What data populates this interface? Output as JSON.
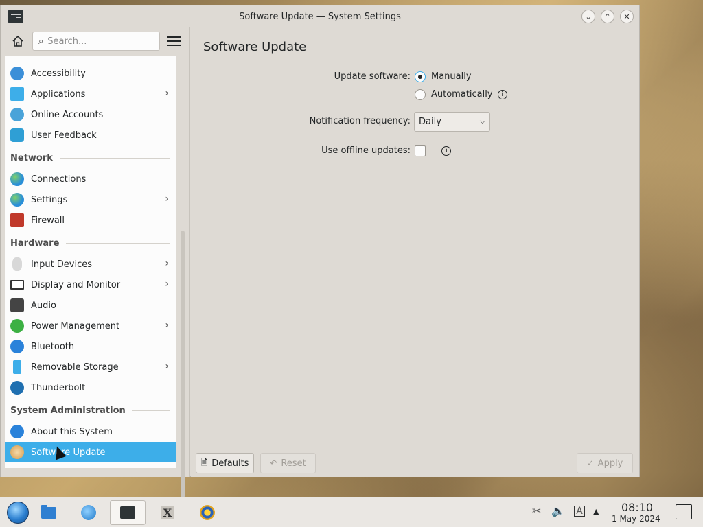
{
  "window": {
    "title": "Software Update — System Settings",
    "buttons": {
      "minimize": "⌄",
      "maximize": "⌃",
      "close": "✕"
    }
  },
  "sidebar": {
    "search_placeholder": "Search...",
    "items_top": [
      {
        "label": "Accessibility",
        "icon": "accessibility-icon",
        "color": "#3b8fd8",
        "chevron": false
      },
      {
        "label": "Applications",
        "icon": "applications-icon",
        "color": "#3daee9",
        "chevron": true
      },
      {
        "label": "Online Accounts",
        "icon": "online-accounts-icon",
        "color": "#4aa3d9",
        "chevron": false
      },
      {
        "label": "User Feedback",
        "icon": "user-feedback-icon",
        "color": "#2f9fd5",
        "chevron": false
      }
    ],
    "sections": {
      "network": "Network",
      "hardware": "Hardware",
      "system_admin": "System Administration"
    },
    "network_items": [
      {
        "label": "Connections",
        "chevron": false
      },
      {
        "label": "Settings",
        "chevron": true
      },
      {
        "label": "Firewall",
        "chevron": false
      }
    ],
    "hardware_items": [
      {
        "label": "Input Devices",
        "chevron": true
      },
      {
        "label": "Display and Monitor",
        "chevron": true
      },
      {
        "label": "Audio",
        "chevron": false
      },
      {
        "label": "Power Management",
        "chevron": true
      },
      {
        "label": "Bluetooth",
        "chevron": false
      },
      {
        "label": "Removable Storage",
        "chevron": true
      },
      {
        "label": "Thunderbolt",
        "chevron": false
      }
    ],
    "admin_items": [
      {
        "label": "About this System",
        "chevron": false
      },
      {
        "label": "Software Update",
        "chevron": false,
        "selected": true
      }
    ]
  },
  "content": {
    "title": "Software Update",
    "update_label": "Update software:",
    "option_manual": "Manually",
    "option_auto": "Automatically",
    "selected_option": "Manually",
    "notif_label": "Notification frequency:",
    "notif_value": "Daily",
    "offline_label": "Use offline updates:",
    "offline_checked": false
  },
  "footer": {
    "defaults": "Defaults",
    "reset": "Reset",
    "apply": "Apply"
  },
  "taskbar": {
    "time": "08:10",
    "date": "1 May 2024"
  },
  "colors": {
    "selection": "#3daee9",
    "window_bg": "#dedad4"
  }
}
